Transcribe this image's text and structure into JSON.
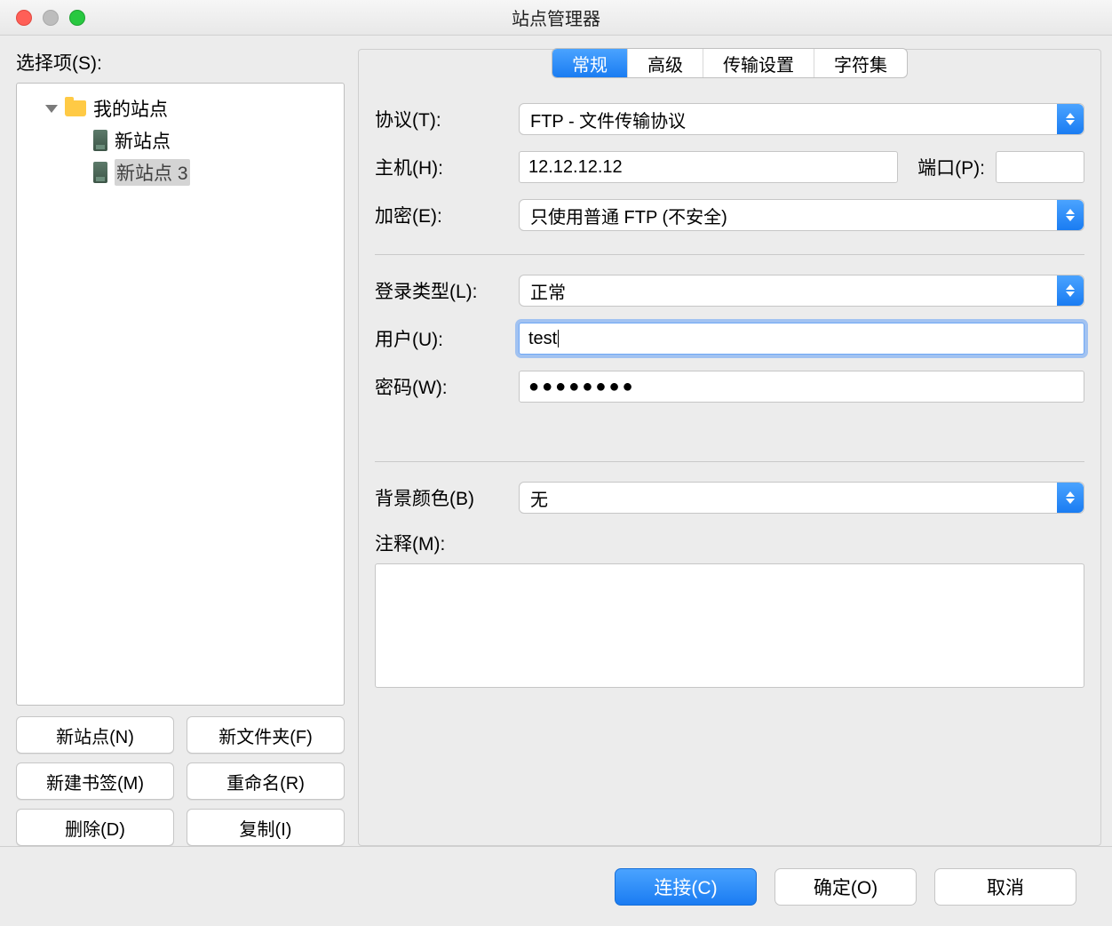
{
  "window": {
    "title": "站点管理器"
  },
  "left": {
    "label": "选择项(S):",
    "tree": {
      "root": "我的站点",
      "items": [
        "新站点",
        "新站点 3"
      ],
      "selected_index": 1
    },
    "buttons": {
      "new_site": "新站点(N)",
      "new_folder": "新文件夹(F)",
      "new_bookmark": "新建书签(M)",
      "rename": "重命名(R)",
      "delete": "删除(D)",
      "copy": "复制(I)"
    }
  },
  "tabs": {
    "items": [
      "常规",
      "高级",
      "传输设置",
      "字符集"
    ],
    "active_index": 0
  },
  "form": {
    "protocol": {
      "label": "协议(T):",
      "value": "FTP - 文件传输协议"
    },
    "host": {
      "label": "主机(H):",
      "value": "12.12.12.12"
    },
    "port": {
      "label": "端口(P):",
      "value": ""
    },
    "encryption": {
      "label": "加密(E):",
      "value": "只使用普通 FTP (不安全)"
    },
    "logon_type": {
      "label": "登录类型(L):",
      "value": "正常"
    },
    "user": {
      "label": "用户(U):",
      "value": "test"
    },
    "password": {
      "label": "密码(W):",
      "value_masked": "●●●●●●●●"
    },
    "bgcolor": {
      "label": "背景颜色(B)",
      "value": "无"
    },
    "comment": {
      "label": "注释(M):",
      "value": ""
    }
  },
  "actions": {
    "connect": "连接(C)",
    "ok": "确定(O)",
    "cancel": "取消"
  }
}
